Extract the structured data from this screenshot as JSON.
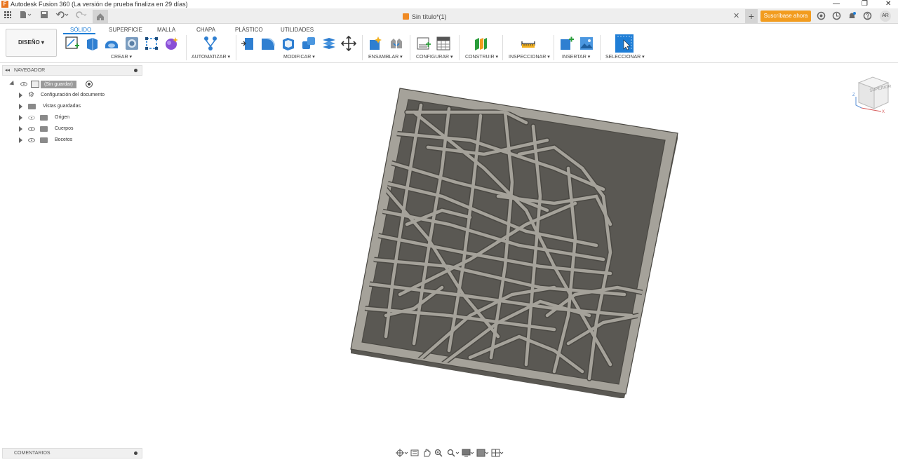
{
  "window": {
    "title": "Autodesk Fusion 360 (La versión de prueba finaliza en 29 días)",
    "logo": "F",
    "minimize": "—",
    "restore": "❐",
    "close": "✕"
  },
  "header": {
    "doc_tab": "Sin título*(1)",
    "close_tab": "✕",
    "new_tab": "+",
    "subscribe": "Suscríbase ahora",
    "avatar": "AR"
  },
  "ribbon": {
    "workspace": "DISEÑO ▾",
    "tabs": [
      "SÓLIDO",
      "SUPERFICIE",
      "MALLA",
      "CHAPA",
      "PLÁSTICO",
      "UTILIDADES"
    ],
    "groups": [
      "CREAR ▾",
      "AUTOMATIZAR ▾",
      "MODIFICAR ▾",
      "ENSAMBLAR ▾",
      "CONFIGURAR ▾",
      "CONSTRUIR ▾",
      "INSPECCIONAR ▾",
      "INSERTAR ▾",
      "SELECCIONAR ▾"
    ]
  },
  "browser": {
    "title": "NAVEGADOR",
    "root": "(Sin guardar)",
    "items": [
      "Configuración del documento",
      "Vistas guardadas",
      "Origen",
      "Cuerpos",
      "Bocetos"
    ]
  },
  "viewcube": {
    "face": "SUPERIOR",
    "axis_x": "X",
    "axis_z": "Z"
  },
  "comments": {
    "title": "COMENTARIOS"
  },
  "colors": {
    "accent": "#1f7ed6",
    "subscribe": "#f29c1f",
    "model": "#9b9890"
  }
}
